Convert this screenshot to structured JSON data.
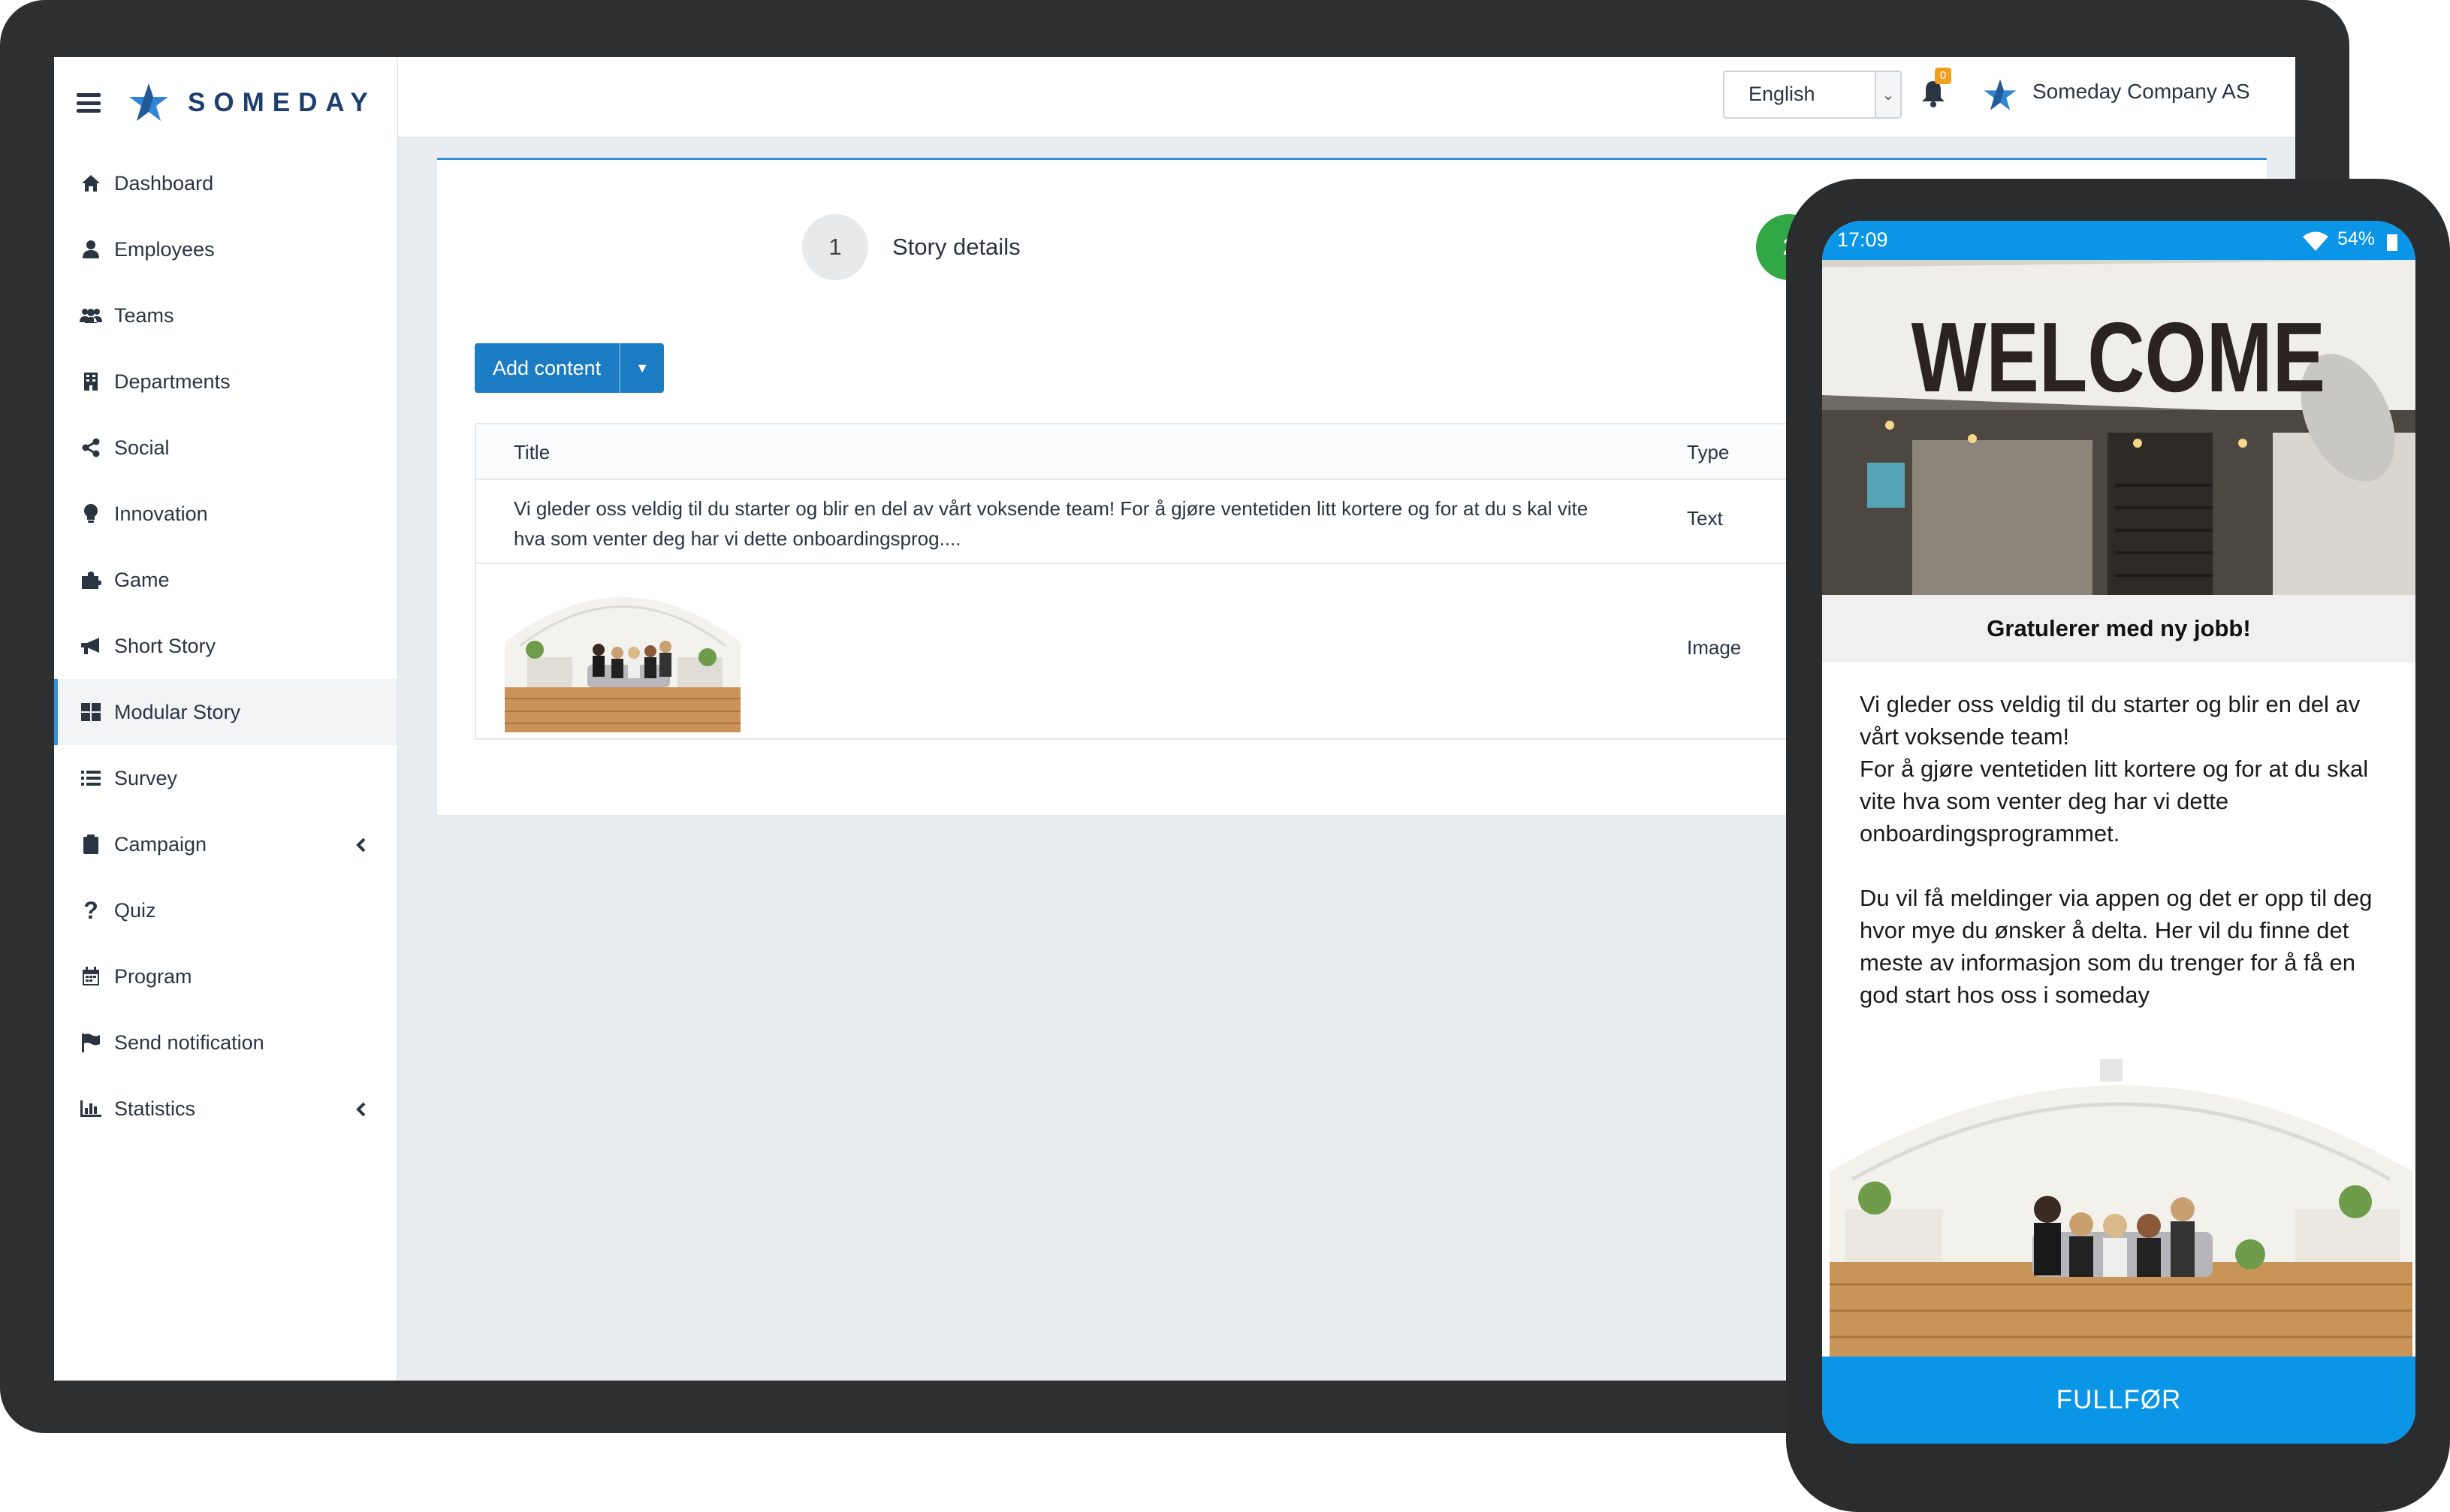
{
  "brand": {
    "name": "SOMEDAY"
  },
  "sidebar": {
    "items": [
      {
        "label": "Dashboard",
        "icon": "home-icon"
      },
      {
        "label": "Employees",
        "icon": "user-icon"
      },
      {
        "label": "Teams",
        "icon": "users-icon"
      },
      {
        "label": "Departments",
        "icon": "building-icon"
      },
      {
        "label": "Social",
        "icon": "share-icon"
      },
      {
        "label": "Innovation",
        "icon": "lightbulb-icon"
      },
      {
        "label": "Game",
        "icon": "puzzle-icon"
      },
      {
        "label": "Short Story",
        "icon": "megaphone-icon"
      },
      {
        "label": "Modular Story",
        "icon": "grid-icon",
        "active": true
      },
      {
        "label": "Survey",
        "icon": "list-icon"
      },
      {
        "label": "Campaign",
        "icon": "clipboard-icon",
        "expandable": true
      },
      {
        "label": "Quiz",
        "icon": "question-icon"
      },
      {
        "label": "Program",
        "icon": "calendar-icon"
      },
      {
        "label": "Send notification",
        "icon": "flag-icon"
      },
      {
        "label": "Statistics",
        "icon": "bar-chart-icon",
        "expandable": true
      }
    ]
  },
  "topbar": {
    "language": "English",
    "notification_count": "0",
    "company": "Someday Company AS"
  },
  "wizard": {
    "step1": {
      "number": "1",
      "label": "Story details"
    },
    "step2": {
      "number": "2"
    }
  },
  "content": {
    "add_button": "Add content",
    "table": {
      "headers": {
        "title": "Title",
        "type": "Type"
      },
      "rows": [
        {
          "title": "Vi gleder oss veldig til du starter og blir en del av vårt voksende team! For å gjøre ventetiden litt kortere og for at du s kal vite hva som venter deg har vi dette onboardingsprog....",
          "type": "Text"
        },
        {
          "title": "",
          "type": "Image"
        }
      ]
    }
  },
  "phone": {
    "time": "17:09",
    "battery": "54%",
    "hero_sign": "WELCOME",
    "greeting": "Gratulerer med ny jobb!",
    "paragraph1": "Vi gleder oss veldig til du starter og blir en del av vårt voksende team!\nFor å gjøre ventetiden litt kortere og for at du skal vite hva som venter deg har vi dette onboardingsprogrammet.",
    "paragraph2": "Du vil få meldinger via appen og det er opp til deg hvor mye du ønsker å delta. Her vil du finne det meste av informasjon som du trenger for å få en god start hos oss i someday",
    "cta": "FULLFØR"
  },
  "colors": {
    "primary": "#1b7bc3",
    "phone_accent": "#0b95e6",
    "step_done": "#31a845",
    "badge": "#f0a020"
  }
}
